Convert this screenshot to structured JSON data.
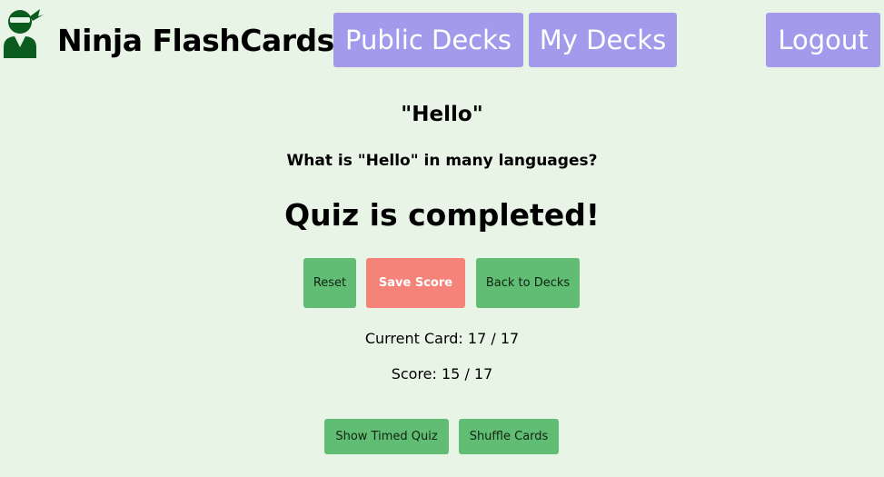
{
  "header": {
    "logo_icon": "ninja-icon",
    "brand": "Ninja FlashCards",
    "nav": {
      "public_decks": "Public Decks",
      "my_decks": "My Decks",
      "logout": "Logout"
    }
  },
  "deck": {
    "title": "\"Hello\"",
    "description": "What is \"Hello\" in many languages?"
  },
  "quiz": {
    "status": "Quiz is completed!",
    "actions": {
      "reset": "Reset",
      "save_score": "Save Score",
      "back": "Back to Decks"
    },
    "current_card_label": "Current Card: 17 / 17",
    "score_label": "Score: 15 / 17",
    "options": {
      "timed": "Show Timed Quiz",
      "shuffle": "Shuffle Cards"
    }
  },
  "colors": {
    "background": "#e8f5e6",
    "nav_button": "#a39aec",
    "green_button": "#61bd73",
    "save_button": "#f58379",
    "logo": "#0b5c1f"
  }
}
